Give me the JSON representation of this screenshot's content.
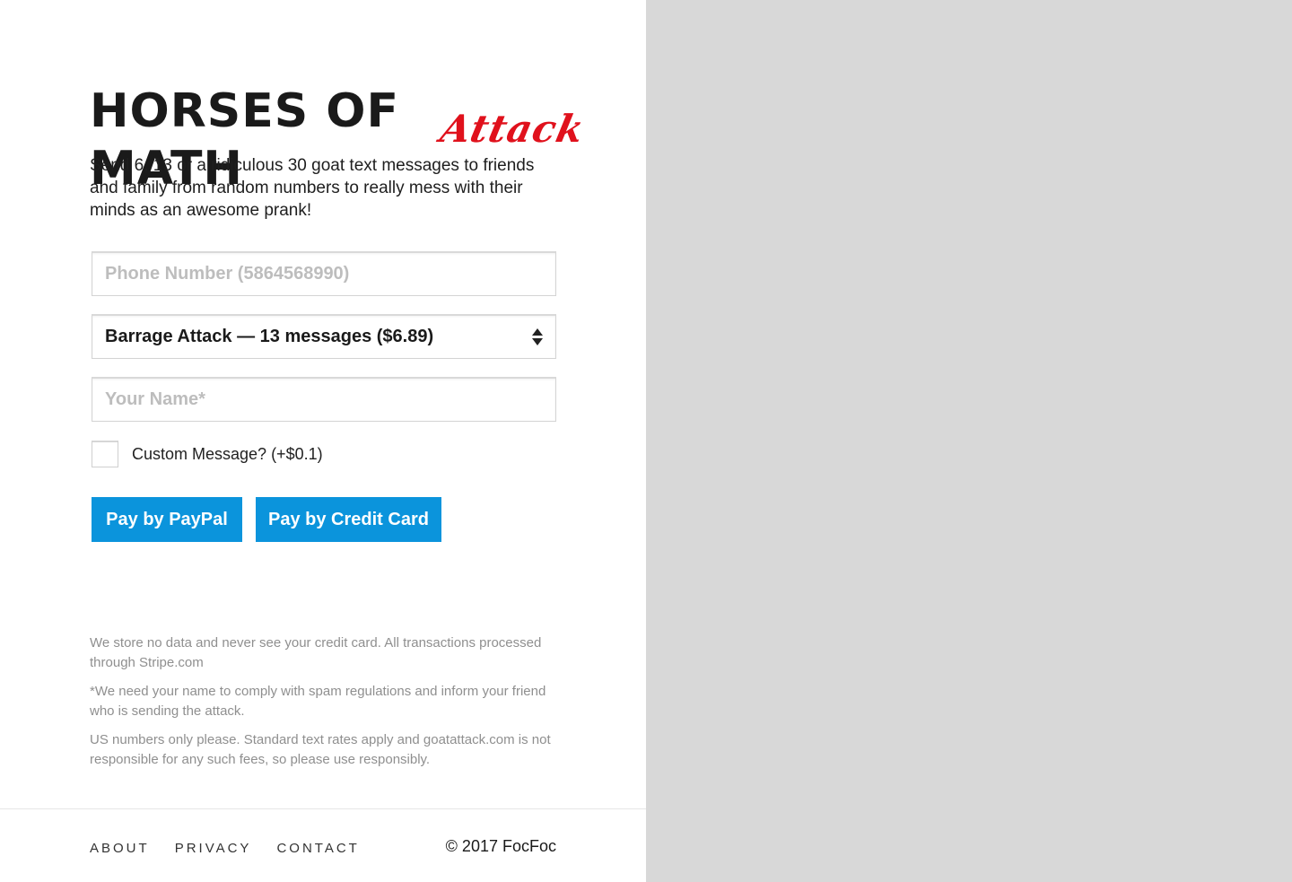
{
  "brand": {
    "title": "HORSES OF MATH",
    "accent": "Attack",
    "accent_color": "#e0111c"
  },
  "intro": "Send 6, 13 or a ridiculous 30 goat text messages to friends and family from random numbers to really mess with their minds as an awesome prank!",
  "form": {
    "phone_placeholder": "Phone Number (5864568990)",
    "package_selected": "Barrage Attack — 13 messages ($6.89)",
    "name_placeholder": "Your Name*",
    "custom_message_label": "Custom Message? (+$0.1)",
    "custom_message_checked": false
  },
  "buttons": {
    "paypal": "Pay by PayPal",
    "card": "Pay by Credit Card",
    "color": "#0b94dc"
  },
  "notes": [
    "We store no data and never see your credit card. All transactions processed through Stripe.com",
    "*We need your name to comply with spam regulations and inform your friend who is sending the attack.",
    "US numbers only please. Standard text rates apply and goatattack.com is not responsible for any such fees, so please use responsibly."
  ],
  "footer": {
    "nav": [
      "ABOUT",
      "PRIVACY",
      "CONTACT"
    ],
    "copyright": "© 2017 FocFoc"
  },
  "right_panel_color": "#d8d8d8"
}
